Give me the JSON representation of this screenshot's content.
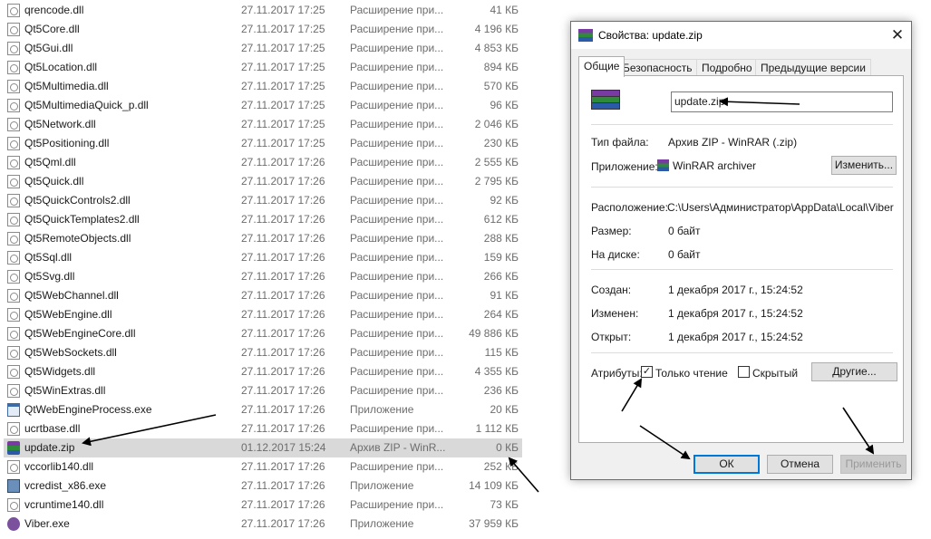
{
  "files": [
    {
      "name": "qrencode.dll",
      "date": "27.11.2017 17:25",
      "type": "Расширение при...",
      "size": "41 КБ",
      "icon": "dll-icon"
    },
    {
      "name": "Qt5Core.dll",
      "date": "27.11.2017 17:25",
      "type": "Расширение при...",
      "size": "4 196 КБ",
      "icon": "dll-icon"
    },
    {
      "name": "Qt5Gui.dll",
      "date": "27.11.2017 17:25",
      "type": "Расширение при...",
      "size": "4 853 КБ",
      "icon": "dll-icon"
    },
    {
      "name": "Qt5Location.dll",
      "date": "27.11.2017 17:25",
      "type": "Расширение при...",
      "size": "894 КБ",
      "icon": "dll-icon"
    },
    {
      "name": "Qt5Multimedia.dll",
      "date": "27.11.2017 17:25",
      "type": "Расширение при...",
      "size": "570 КБ",
      "icon": "dll-icon"
    },
    {
      "name": "Qt5MultimediaQuick_p.dll",
      "date": "27.11.2017 17:25",
      "type": "Расширение при...",
      "size": "96 КБ",
      "icon": "dll-icon"
    },
    {
      "name": "Qt5Network.dll",
      "date": "27.11.2017 17:25",
      "type": "Расширение при...",
      "size": "2 046 КБ",
      "icon": "dll-icon"
    },
    {
      "name": "Qt5Positioning.dll",
      "date": "27.11.2017 17:25",
      "type": "Расширение при...",
      "size": "230 КБ",
      "icon": "dll-icon"
    },
    {
      "name": "Qt5Qml.dll",
      "date": "27.11.2017 17:26",
      "type": "Расширение при...",
      "size": "2 555 КБ",
      "icon": "dll-icon"
    },
    {
      "name": "Qt5Quick.dll",
      "date": "27.11.2017 17:26",
      "type": "Расширение при...",
      "size": "2 795 КБ",
      "icon": "dll-icon"
    },
    {
      "name": "Qt5QuickControls2.dll",
      "date": "27.11.2017 17:26",
      "type": "Расширение при...",
      "size": "92 КБ",
      "icon": "dll-icon"
    },
    {
      "name": "Qt5QuickTemplates2.dll",
      "date": "27.11.2017 17:26",
      "type": "Расширение при...",
      "size": "612 КБ",
      "icon": "dll-icon"
    },
    {
      "name": "Qt5RemoteObjects.dll",
      "date": "27.11.2017 17:26",
      "type": "Расширение при...",
      "size": "288 КБ",
      "icon": "dll-icon"
    },
    {
      "name": "Qt5Sql.dll",
      "date": "27.11.2017 17:26",
      "type": "Расширение при...",
      "size": "159 КБ",
      "icon": "dll-icon"
    },
    {
      "name": "Qt5Svg.dll",
      "date": "27.11.2017 17:26",
      "type": "Расширение при...",
      "size": "266 КБ",
      "icon": "dll-icon"
    },
    {
      "name": "Qt5WebChannel.dll",
      "date": "27.11.2017 17:26",
      "type": "Расширение при...",
      "size": "91 КБ",
      "icon": "dll-icon"
    },
    {
      "name": "Qt5WebEngine.dll",
      "date": "27.11.2017 17:26",
      "type": "Расширение при...",
      "size": "264 КБ",
      "icon": "dll-icon"
    },
    {
      "name": "Qt5WebEngineCore.dll",
      "date": "27.11.2017 17:26",
      "type": "Расширение при...",
      "size": "49 886 КБ",
      "icon": "dll-icon"
    },
    {
      "name": "Qt5WebSockets.dll",
      "date": "27.11.2017 17:26",
      "type": "Расширение при...",
      "size": "115 КБ",
      "icon": "dll-icon"
    },
    {
      "name": "Qt5Widgets.dll",
      "date": "27.11.2017 17:26",
      "type": "Расширение при...",
      "size": "4 355 КБ",
      "icon": "dll-icon"
    },
    {
      "name": "Qt5WinExtras.dll",
      "date": "27.11.2017 17:26",
      "type": "Расширение при...",
      "size": "236 КБ",
      "icon": "dll-icon"
    },
    {
      "name": "QtWebEngineProcess.exe",
      "date": "27.11.2017 17:26",
      "type": "Приложение",
      "size": "20 КБ",
      "icon": "exe-icon"
    },
    {
      "name": "ucrtbase.dll",
      "date": "27.11.2017 17:26",
      "type": "Расширение при...",
      "size": "1 112 КБ",
      "icon": "dll-icon"
    },
    {
      "name": "update.zip",
      "date": "01.12.2017 15:24",
      "type": "Архив ZIP - WinR...",
      "size": "0 КБ",
      "icon": "winrar-icon",
      "selected": true
    },
    {
      "name": "vccorlib140.dll",
      "date": "27.11.2017 17:26",
      "type": "Расширение при...",
      "size": "252 КБ",
      "icon": "dll-icon"
    },
    {
      "name": "vcredist_x86.exe",
      "date": "27.11.2017 17:26",
      "type": "Приложение",
      "size": "14 109 КБ",
      "icon": "setup-icon"
    },
    {
      "name": "vcruntime140.dll",
      "date": "27.11.2017 17:26",
      "type": "Расширение при...",
      "size": "73 КБ",
      "icon": "dll-icon"
    },
    {
      "name": "Viber.exe",
      "date": "27.11.2017 17:26",
      "type": "Приложение",
      "size": "37 959 КБ",
      "icon": "viber-icon"
    }
  ],
  "dialog": {
    "title": "Свойства: update.zip",
    "close_glyph": "✕",
    "tabs": [
      "Общие",
      "Безопасность",
      "Подробно",
      "Предыдущие версии"
    ],
    "active_tab": 0,
    "filename": "update.zip",
    "file_type_label": "Тип файла:",
    "file_type": "Архив ZIP - WinRAR (.zip)",
    "app_label": "Приложение:",
    "app": "WinRAR archiver",
    "change_button": "Изменить...",
    "location_label": "Расположение:",
    "location": "C:\\Users\\Администратор\\AppData\\Local\\Viber",
    "size_label": "Размер:",
    "size": "0 байт",
    "disk_label": "На диске:",
    "disk": "0 байт",
    "created_label": "Создан:",
    "created": "1 декабря 2017 г., 15:24:52",
    "modified_label": "Изменен:",
    "modified": "1 декабря 2017 г., 15:24:52",
    "opened_label": "Открыт:",
    "opened": "1 декабря 2017 г., 15:24:52",
    "attributes_label": "Атрибуты:",
    "readonly_label": "Только чтение",
    "readonly_checked": true,
    "readonly_mark": "✓",
    "hidden_label": "Скрытый",
    "hidden_checked": false,
    "other_button": "Другие...",
    "ok_button": "ОК",
    "cancel_button": "Отмена",
    "apply_button": "Применить",
    "apply_enabled": false
  },
  "colors": {
    "accent": "#0078d7",
    "selection": "#d9d9d9"
  }
}
